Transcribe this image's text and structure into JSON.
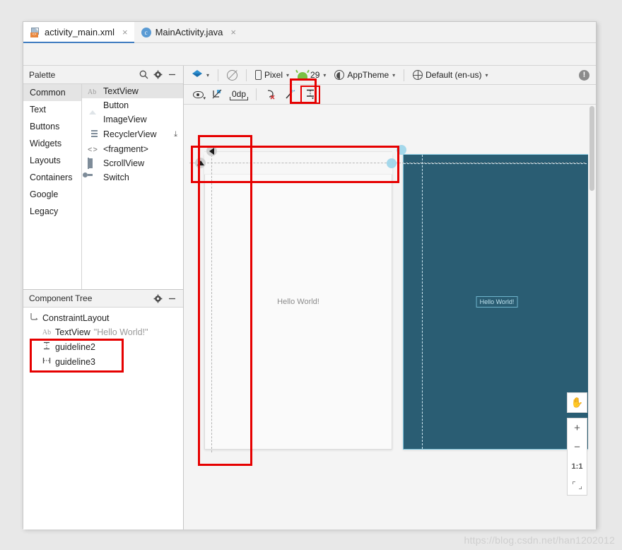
{
  "window": {
    "tabs": [
      {
        "label": "activity_main.xml",
        "icon": "xml-file-icon",
        "active": true,
        "close": "×"
      },
      {
        "label": "MainActivity.java",
        "icon": "java-class-icon",
        "active": false,
        "close": "×"
      }
    ]
  },
  "palette": {
    "title": "Palette",
    "icons": {
      "search": "search-icon",
      "settings": "gear-icon",
      "minimize": "minimize-icon"
    },
    "categories": [
      {
        "label": "Common",
        "selected": true
      },
      {
        "label": "Text",
        "selected": false
      },
      {
        "label": "Buttons",
        "selected": false
      },
      {
        "label": "Widgets",
        "selected": false
      },
      {
        "label": "Layouts",
        "selected": false
      },
      {
        "label": "Containers",
        "selected": false
      },
      {
        "label": "Google",
        "selected": false
      },
      {
        "label": "Legacy",
        "selected": false
      }
    ],
    "items": [
      {
        "label": "TextView",
        "icon": "textview-icon",
        "selected": true,
        "download": ""
      },
      {
        "label": "Button",
        "icon": "button-icon",
        "selected": false,
        "download": ""
      },
      {
        "label": "ImageView",
        "icon": "imageview-icon",
        "selected": false,
        "download": ""
      },
      {
        "label": "RecyclerView",
        "icon": "recyclerview-icon",
        "selected": false,
        "download": "⤓"
      },
      {
        "label": "<fragment>",
        "icon": "fragment-icon",
        "selected": false,
        "download": ""
      },
      {
        "label": "ScrollView",
        "icon": "scrollview-icon",
        "selected": false,
        "download": ""
      },
      {
        "label": "Switch",
        "icon": "switch-icon",
        "selected": false,
        "download": ""
      }
    ]
  },
  "component_tree": {
    "title": "Component Tree",
    "icons": {
      "settings": "gear-icon",
      "minimize": "minimize-icon"
    },
    "nodes": [
      {
        "label": "ConstraintLayout",
        "value": "",
        "icon": "constraintlayout-icon",
        "level": 1
      },
      {
        "label": "TextView",
        "value": "\"Hello World!\"",
        "icon": "textview-icon",
        "level": 2
      },
      {
        "label": "guideline2",
        "value": "",
        "icon": "horizontal-guideline-icon",
        "level": 2
      },
      {
        "label": "guideline3",
        "value": "",
        "icon": "vertical-guideline-icon",
        "level": 2
      }
    ]
  },
  "design_toolbar": {
    "design_mode_icon": "layers-icon",
    "blueprint_toggle_icon": "blueprint-off-icon",
    "device": {
      "label": "Pixel",
      "icon": "phone-icon",
      "caret": "⌄"
    },
    "api": {
      "label": "29",
      "icon": "android-icon",
      "caret": "⌄"
    },
    "theme": {
      "label": "AppTheme",
      "icon": "theme-icon",
      "caret": "⌄"
    },
    "locale": {
      "label": "Default (en-us)",
      "icon": "globe-icon",
      "caret": "⌄"
    },
    "warning_icon": "warning-icon",
    "warning_label": "!"
  },
  "constraint_toolbar": {
    "buttons": [
      {
        "name": "view-options-icon",
        "label": "",
        "selected": false
      },
      {
        "name": "clear-constraints-icon",
        "label": "",
        "selected": false
      },
      {
        "name": "default-margin-field",
        "label": "0dp",
        "selected": false
      },
      {
        "name": "clear-all-constraints-icon",
        "label": "",
        "selected": false
      },
      {
        "name": "infer-constraints-icon",
        "label": "",
        "selected": false
      },
      {
        "name": "guidelines-menu-icon",
        "label": "",
        "selected": true
      }
    ]
  },
  "canvas": {
    "render_text": "Hello World!",
    "blueprint_text": "Hello World!",
    "blueprint_color": "#2a5d73",
    "selection_color": "#7fc4dc"
  },
  "zoom_controls": {
    "pan": {
      "icon": "pan-hand-icon",
      "label": "✋"
    },
    "zoom_in": {
      "icon": "zoom-in-icon",
      "label": "+"
    },
    "zoom_out": {
      "icon": "zoom-out-icon",
      "label": "−"
    },
    "actual_size": {
      "icon": "actual-size-icon",
      "label": "1:1"
    },
    "fit_screen": {
      "icon": "fit-to-screen-icon",
      "label": ""
    }
  },
  "annotations": {
    "highlight_color": "#e60000",
    "boxes": [
      "guidelines-menu-toolbar-button",
      "component-tree-guidelines",
      "canvas-vertical-guideline",
      "canvas-horizontal-guideline"
    ]
  },
  "watermark": {
    "text": "https://blog.csdn.net/han1202012"
  }
}
